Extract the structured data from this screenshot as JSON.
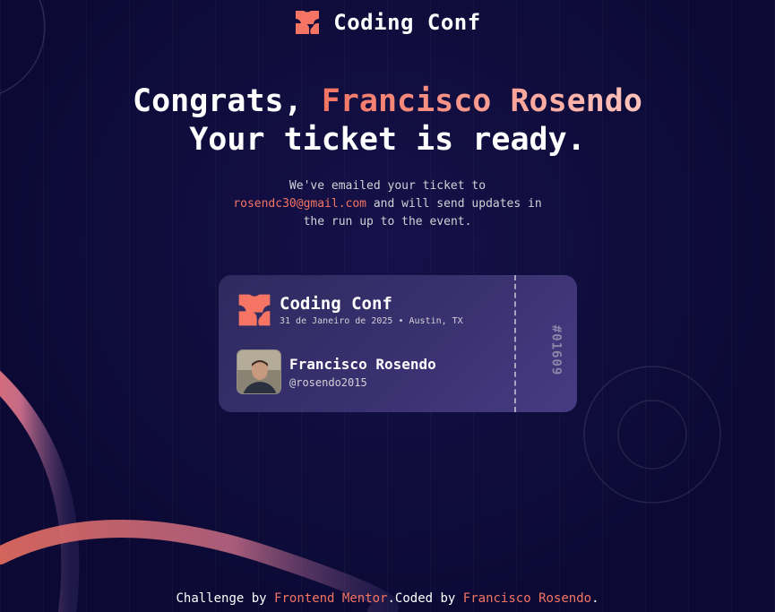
{
  "brand": {
    "name": "Coding Conf",
    "icon": "coding-conf-logo-icon"
  },
  "headline": {
    "prefix": "Congrats, ",
    "name": "Francisco Rosendo",
    "suffix": "",
    "line2": "Your ticket is ready."
  },
  "message": {
    "line1": "We've emailed your ticket to",
    "email": "rosendc30@gmail.com",
    "after_email": " and will send updates in",
    "line3": "the run up to the event."
  },
  "ticket": {
    "event_name": "Coding Conf",
    "date_location": "31 de Janeiro de 2025 • Austin, TX",
    "user_name": "Francisco Rosendo",
    "user_handle": "@rosendo2015",
    "ticket_number": "#01609"
  },
  "footer": {
    "prefix": "Challenge by ",
    "link1": "Frontend Mentor",
    "middle": ".Coded by ",
    "link2": "Francisco Rosendo",
    "suffix": "."
  },
  "colors": {
    "background": "#0c0a35",
    "accent": "#f57463",
    "ticket_bg": "#3a3170"
  }
}
